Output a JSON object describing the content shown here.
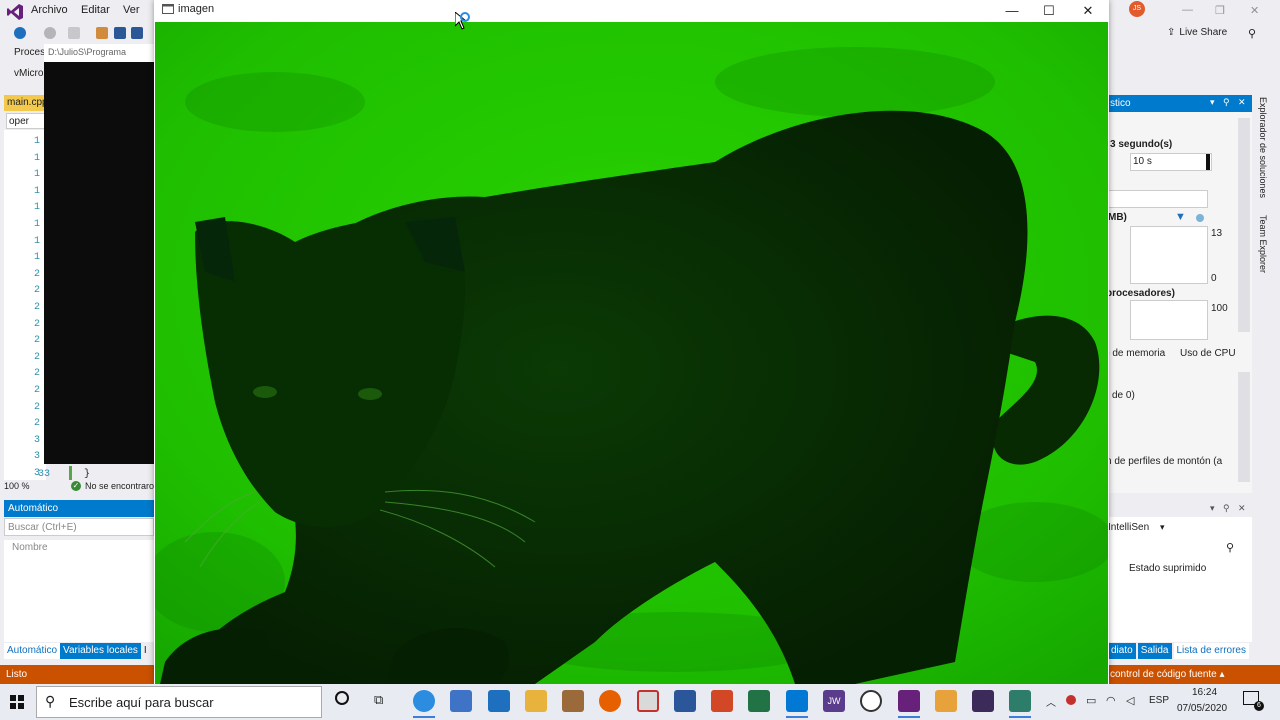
{
  "vs": {
    "menu": [
      "Archivo",
      "Editar",
      "Ver"
    ],
    "avatar_initials": "JS",
    "live_share": "Live Share",
    "left_labels": {
      "proces": "Proces",
      "vmicro": "vMicro"
    },
    "file_tab": "main.cpp",
    "scope_label": "oper",
    "console_title": "D:\\JulioS\\Programa",
    "line_numbers": [
      "1",
      "1",
      "1",
      "1",
      "1",
      "1",
      "1",
      "1",
      "2",
      "2",
      "2",
      "2",
      "2",
      "2",
      "2",
      "2",
      "2",
      "2",
      "3",
      "3",
      "3",
      "3"
    ],
    "last_line": "33",
    "last_code": "}",
    "zoom": "100 %",
    "issues": "No se encontraron",
    "auto_panel": {
      "title": "Automático",
      "search_placeholder": "Buscar (Ctrl+E)",
      "column": "Nombre"
    },
    "bottom_tabs": [
      "Automático",
      "Variables locales",
      "I"
    ],
    "status": "Listo",
    "diag": {
      "header": "stico",
      "session_label": "3 segundo(s)",
      "timeline_value": "10 s",
      "memory_label": "MB)",
      "mem_max": "13",
      "mem_min": "0",
      "cpu_label": "procesadores)",
      "cpu_max": "100",
      "tabs": [
        "o de memoria",
        "Uso de CPU"
      ],
      "row1": "de 0)",
      "row2": "n de perfiles de montón (a",
      "side_tabs": [
        "Explorador de soluciones",
        "Team Explorer"
      ]
    },
    "output": {
      "source": "IntelliSen",
      "col": "Estado suprimido"
    },
    "right_bottom_tabs": [
      "diato",
      "Salida",
      "Lista de errores"
    ],
    "right_status": "control de código fuente"
  },
  "image_window": {
    "title": "imagen"
  },
  "taskbar": {
    "search_placeholder": "Escribe aquí para buscar",
    "lang": "ESP",
    "time": "16:24",
    "date": "07/05/2020",
    "notifications": "6",
    "apps": [
      "cortana",
      "task-view",
      "edge",
      "store",
      "mail",
      "explorer",
      "app",
      "firefox",
      "pdf",
      "word",
      "powerpoint",
      "excel",
      "vscode",
      "jw",
      "obs",
      "visual-studio",
      "package",
      "terminal",
      "image"
    ]
  },
  "colors": {
    "accent": "#007acc",
    "status": "#ca5100",
    "image_tint": "#1fbf00"
  }
}
